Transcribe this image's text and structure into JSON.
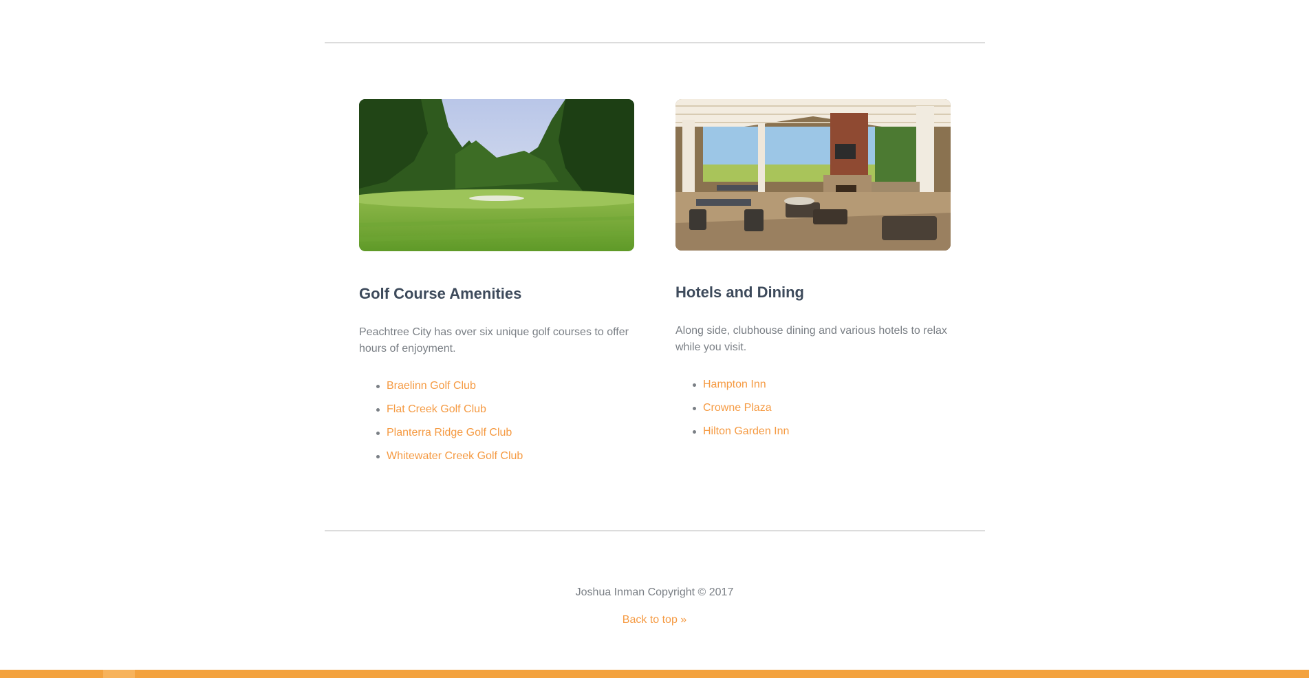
{
  "sections": [
    {
      "heading": "Golf Course Amenities",
      "description": "Peachtree City has over six unique golf courses to offer hours of enjoyment.",
      "links": [
        "Braelinn Golf Club",
        "Flat Creek Golf Club",
        "Planterra Ridge Golf Club",
        "Whitewater Creek Golf Club"
      ]
    },
    {
      "heading": "Hotels and Dining",
      "description": "Along side, clubhouse dining and various hotels to relax while you visit.",
      "links": [
        "Hampton Inn",
        "Crowne Plaza",
        "Hilton Garden Inn"
      ]
    }
  ],
  "footer": {
    "copyright": "Joshua Inman Copyright © 2017",
    "back_to_top": "Back to top »"
  },
  "colors": {
    "link": "#f59a42",
    "heading": "#3d4a5b",
    "body_text": "#7a7f85",
    "rule": "#dcdcdc",
    "bottom_bar": "#f3a23e"
  }
}
